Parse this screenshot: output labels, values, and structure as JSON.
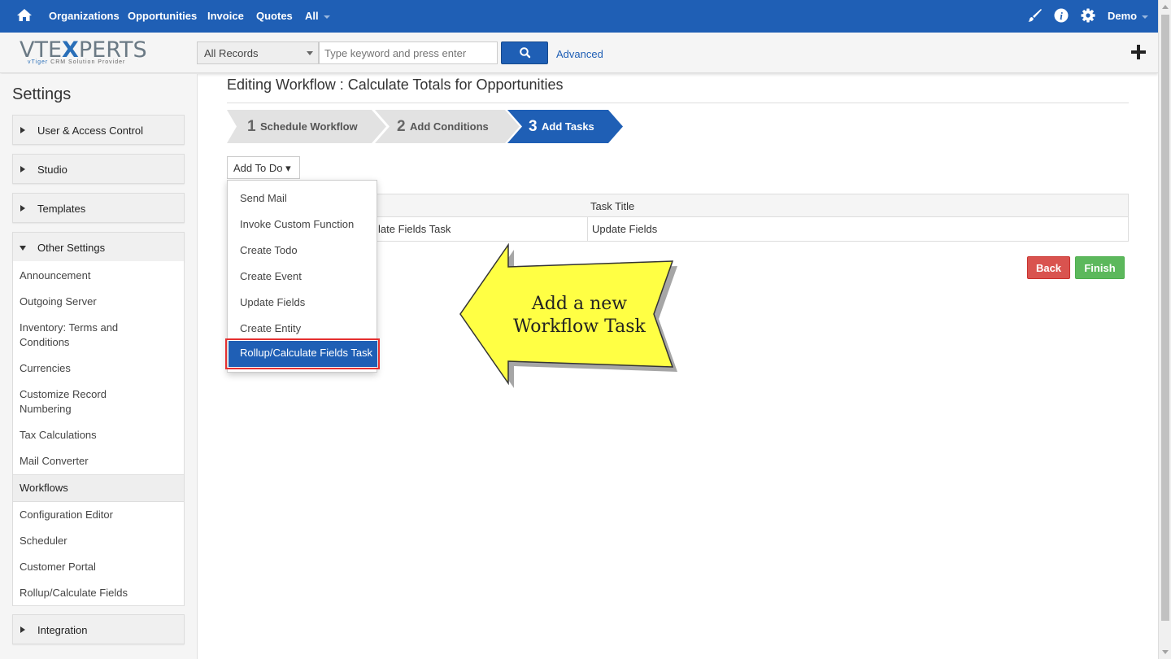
{
  "topnav": {
    "items": [
      "Organizations",
      "Opportunities",
      "Invoice",
      "Quotes",
      "All"
    ],
    "user": "Demo"
  },
  "header": {
    "record_filter": "All Records",
    "search_placeholder": "Type keyword and press enter",
    "advanced": "Advanced"
  },
  "sidebar": {
    "title": "Settings",
    "groups": [
      "User & Access Control",
      "Studio",
      "Templates",
      "Other Settings",
      "Integration"
    ],
    "other_items": [
      "Announcement",
      "Outgoing Server",
      "Inventory: Terms and Conditions",
      "Currencies",
      "Customize Record Numbering",
      "Tax Calculations",
      "Mail Converter",
      "Workflows",
      "Configuration Editor",
      "Scheduler",
      "Customer Portal",
      "Rollup/Calculate Fields"
    ]
  },
  "main": {
    "title": "Editing Workflow : Calculate Totals for Opportunities",
    "steps": [
      {
        "num": "1",
        "label": "Schedule Workflow"
      },
      {
        "num": "2",
        "label": "Add Conditions"
      },
      {
        "num": "3",
        "label": "Add Tasks"
      }
    ],
    "add_button": "Add To Do ▾",
    "dropdown": [
      "Send Mail",
      "Invoke Custom Function",
      "Create Todo",
      "Create Event",
      "Update Fields",
      "Create Entity",
      "Rollup/Calculate Fields Task"
    ],
    "table": {
      "header_title": "Task Title",
      "row_type": "late Fields Task",
      "row_title": "Update Fields"
    },
    "back": "Back",
    "finish": "Finish",
    "callout": "Add a new Workflow Task"
  },
  "colors": {
    "primary": "#1f5fb5",
    "danger": "#d9534f",
    "success": "#5cb85c",
    "callout": "#ffff44",
    "highlight": "#e53030"
  },
  "icons": [
    "home-icon",
    "brush-icon",
    "info-icon",
    "gear-icon",
    "search-icon",
    "plus-icon"
  ]
}
